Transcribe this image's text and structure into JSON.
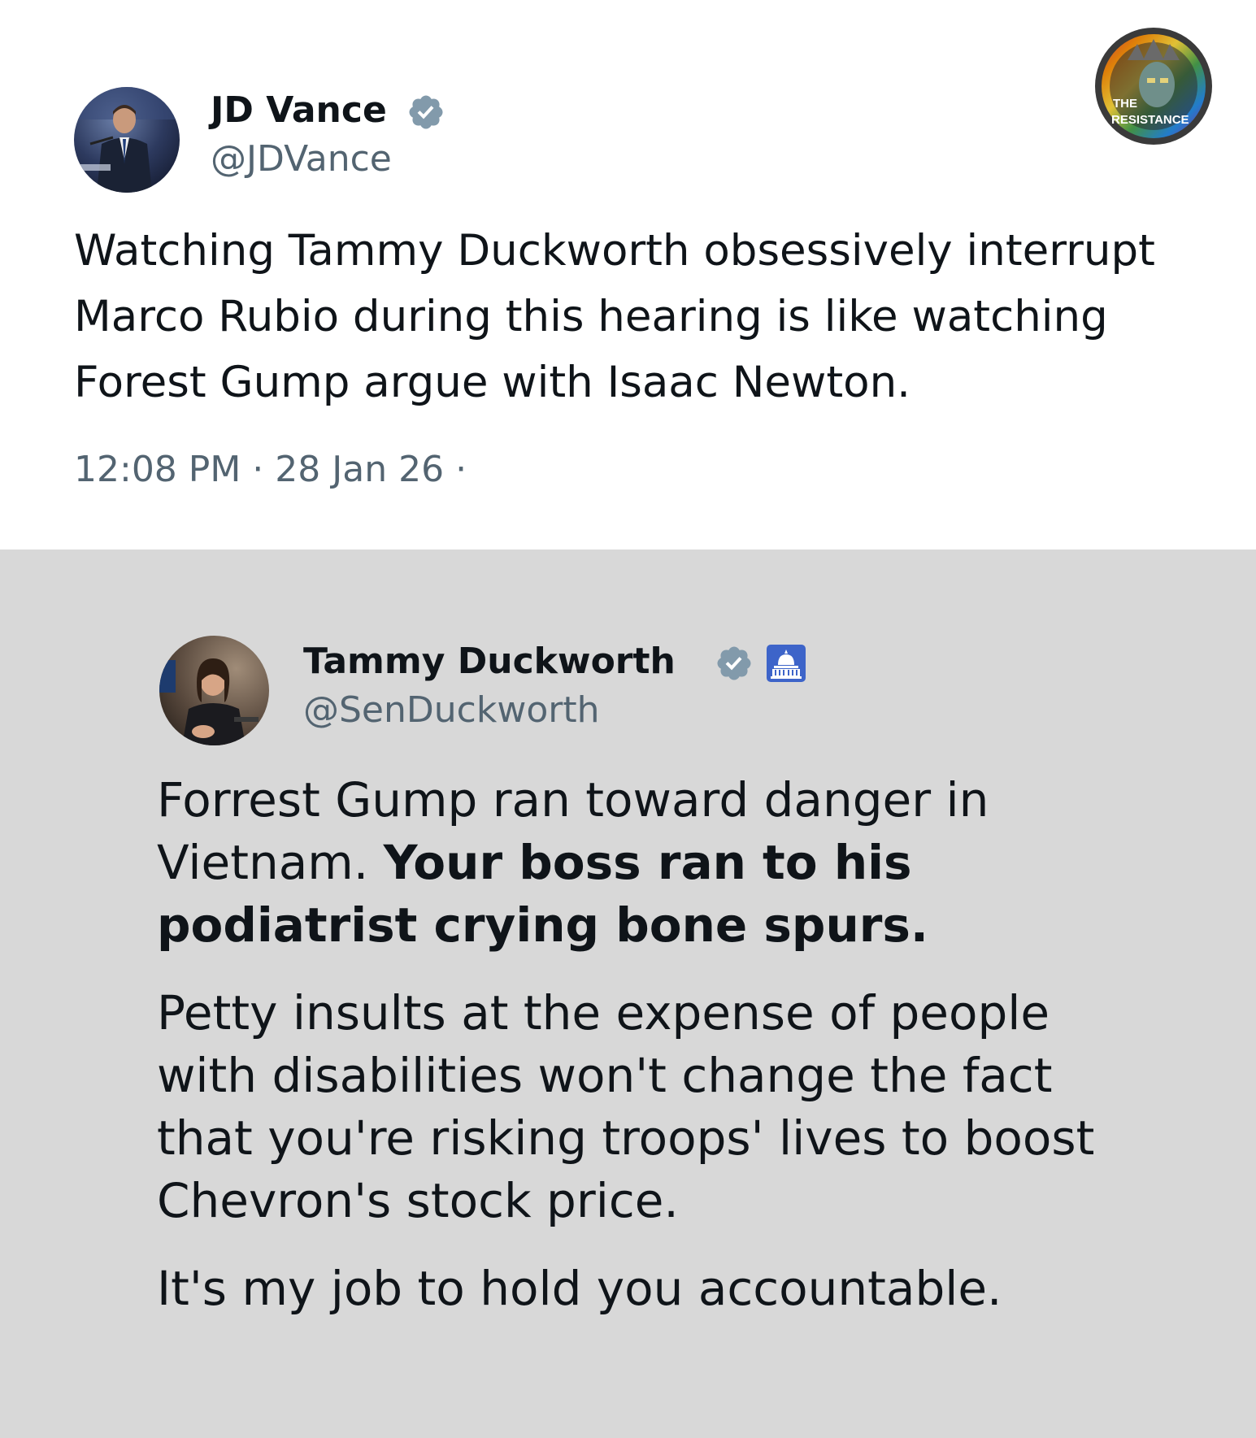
{
  "tweet_top": {
    "author_name": "JD Vance",
    "author_handle": "@JDVance",
    "text": "Watching Tammy Duckworth obsessively interrupt Marco Rubio during this hearing is like watching Forest Gump argue with Isaac Newton.",
    "time": "12:08 PM",
    "separator": "·",
    "date": "28 Jan 26",
    "trailing": "·"
  },
  "tweet_bottom": {
    "author_name": "Tammy Duckworth",
    "author_handle": "@SenDuckworth",
    "paragraph1_normal": "Forrest Gump ran toward danger in Vietnam. ",
    "paragraph1_bold": "Your boss ran to his podiatrist crying bone spurs.",
    "paragraph2": "Petty insults at the expense of people with disabilities won't change the fact that you're risking troops' lives to boost Chevron's stock price.",
    "paragraph3": "It's my job to hold you accountable."
  },
  "watermark": {
    "line1": "THE",
    "line2": "RESISTANCE"
  },
  "colors": {
    "text_primary": "#0f1419",
    "text_secondary": "#536471",
    "verified_badge": "#829aab",
    "bottom_bg": "#d8d8d8",
    "top_bg": "#ffffff"
  },
  "icons": {
    "verified": "verified-badge-icon",
    "government": "capitol-building-icon"
  }
}
